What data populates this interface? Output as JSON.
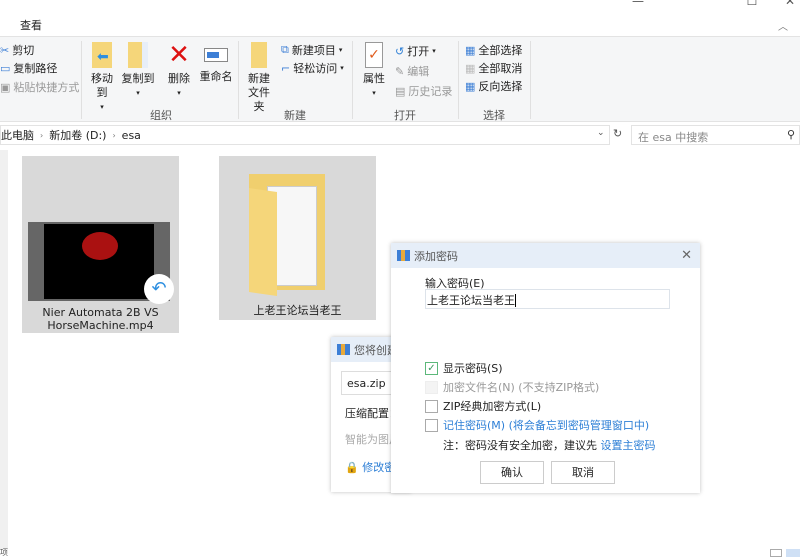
{
  "ribbon": {
    "tab_view": "查看",
    "clipboard": {
      "cut": "剪切",
      "copy_path": "复制路径",
      "paste_shortcut": "粘贴快捷方式"
    },
    "organize": {
      "move_to": "移动到",
      "copy_to": "复制到",
      "delete": "删除",
      "rename": "重命名",
      "group": "组织"
    },
    "new": {
      "new_folder_1": "新建",
      "new_folder_2": "文件夹",
      "new_item": "新建项目",
      "easy_access": "轻松访问",
      "group": "新建"
    },
    "open": {
      "properties": "属性",
      "open": "打开",
      "edit": "编辑",
      "history": "历史记录",
      "group": "打开"
    },
    "select": {
      "select_all": "全部选择",
      "select_none": "全部取消",
      "invert": "反向选择",
      "group": "选择"
    }
  },
  "address": {
    "crumbs": [
      "此电脑",
      "新加卷 (D:)",
      "esa"
    ],
    "search_placeholder": "在 esa 中搜索"
  },
  "files": [
    {
      "name_1": "Nier Automata 2B VS",
      "name_2": "HorseMachine.mp4",
      "type": "video"
    },
    {
      "name": "上老王论坛当老王",
      "type": "folder"
    }
  ],
  "back_dialog": {
    "title": "您将创建",
    "filename": "esa.zip",
    "config_label": "压缩配置：",
    "smart": "智能为图片",
    "change_pwd": "修改密码"
  },
  "password_dialog": {
    "title": "添加密码",
    "input_label": "输入密码(E)",
    "password": "上老王论坛当老王",
    "show_password": "显示密码(S)",
    "show_password_checked": true,
    "encrypt_names": "加密文件名(N) (不支持ZIP格式)",
    "zip_classic": "ZIP经典加密方式(L)",
    "remember": "记住密码(M) (将会备忘到密码管理窗口中)",
    "note": "注：密码没有安全加密，建议先",
    "note_link": "设置主密码",
    "ok": "确认",
    "cancel": "取消"
  },
  "status": {
    "items": "项"
  }
}
